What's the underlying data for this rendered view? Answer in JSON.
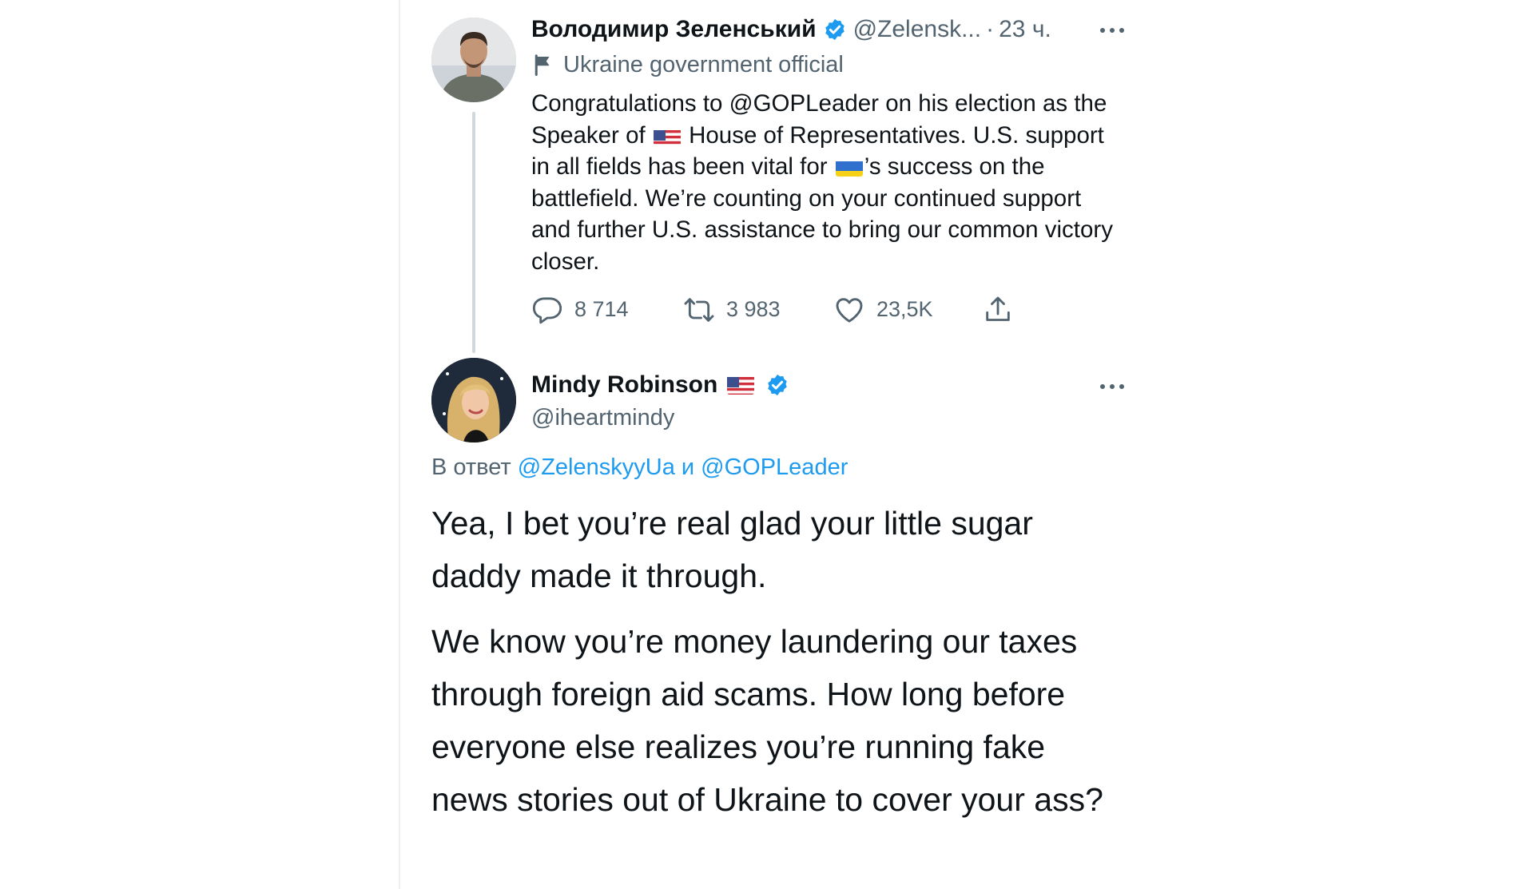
{
  "tweet1": {
    "name": "Володимир Зеленський",
    "handle": "@Zelensk...",
    "separator": "·",
    "time": "23 ч.",
    "label": "Ukraine government official",
    "text_part1": "Congratulations to @GOPLeader on his election as the Speaker of ",
    "text_part2": " House of Representatives. U.S. support in all fields has been vital for ",
    "text_part3": "’s success on the battlefield. We’re counting on your continued support and further U.S. assistance to bring our common victory closer.",
    "replies": "8 714",
    "retweets": "3 983",
    "likes": "23,5K",
    "icons": [
      "verified-icon",
      "more-icon",
      "flag-icon",
      "reply-icon",
      "retweet-icon",
      "like-icon",
      "share-icon"
    ]
  },
  "tweet2": {
    "name": "Mindy Robinson",
    "handle": "@iheartmindy",
    "reply_prefix": "В ответ ",
    "reply_user1": "@ZelenskyyUa",
    "reply_and": " и ",
    "reply_user2": "@GOPLeader",
    "paragraph1": "Yea, I bet you’re real glad your little sugar daddy made it through.",
    "paragraph2": "We know you’re money laundering our taxes through foreign aid scams. How long before everyone else realizes you’re running fake news stories out of Ukraine to cover your ass?"
  },
  "colors": {
    "text": "#0f1419",
    "muted": "#536471",
    "link": "#1d9bf0",
    "verified": "#1d9bf0"
  }
}
